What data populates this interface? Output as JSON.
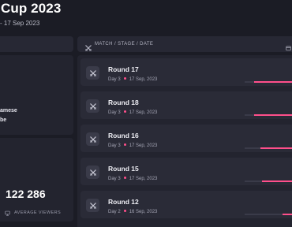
{
  "header": {
    "title": "Cup 2023",
    "subtitle": "- 17 Sep 2023"
  },
  "left_panel": {
    "card_lines": [
      "amese",
      "be"
    ],
    "viewers": {
      "value": "122 286",
      "label": "AVERAGE VIEWERS"
    }
  },
  "match_table": {
    "header_label": "MATCH / STAGE / DATE",
    "rows": [
      {
        "name": "Round 17",
        "day": "Day 3",
        "date": "17 Sep, 2023",
        "bar_fraction": 0.82
      },
      {
        "name": "Round 18",
        "day": "Day 3",
        "date": "17 Sep, 2023",
        "bar_fraction": 0.82
      },
      {
        "name": "Round 16",
        "day": "Day 3",
        "date": "17 Sep, 2023",
        "bar_fraction": 0.7
      },
      {
        "name": "Round 15",
        "day": "Day 3",
        "date": "17 Sep, 2023",
        "bar_fraction": 0.68
      },
      {
        "name": "Round 12",
        "day": "Day 2",
        "date": "16 Sep, 2023",
        "bar_fraction": 0.3
      }
    ]
  },
  "colors": {
    "accent": "#ff4f8b",
    "background": "#1b1c25",
    "panel": "#23242f"
  },
  "icons": {
    "match_icon": "crossed-swords-icon",
    "viewers_icon": "screen-icon"
  }
}
